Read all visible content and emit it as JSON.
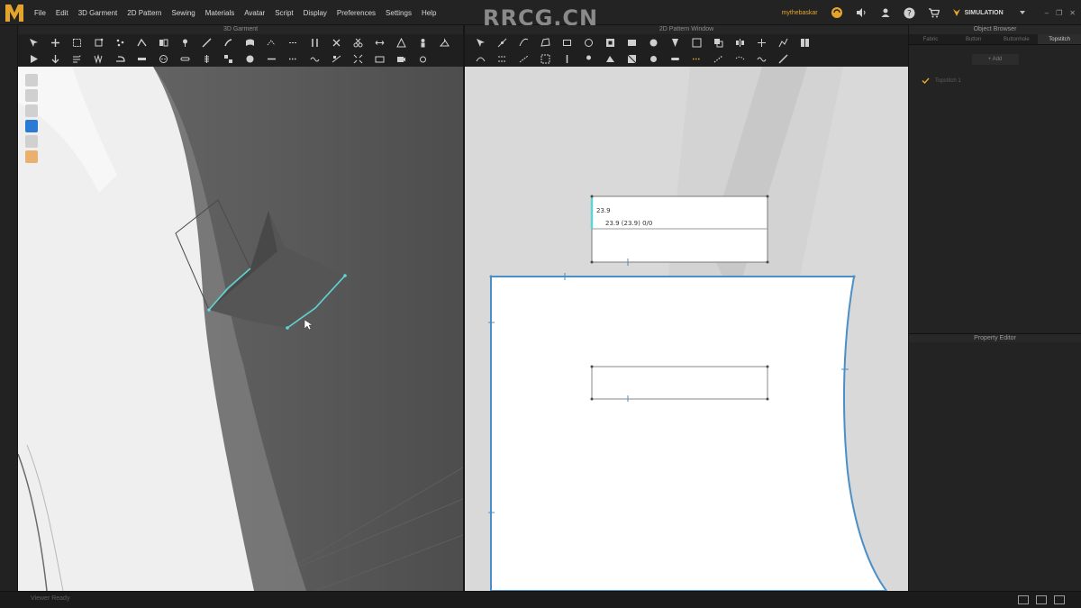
{
  "app": {
    "logo_glyph": "M",
    "brand_watermark": "RRCG.CN",
    "user_name": "mythebaskar",
    "mode_label": "SIMULATION"
  },
  "menu": [
    "File",
    "Edit",
    "3D Garment",
    "2D Pattern",
    "Sewing",
    "Materials",
    "Avatar",
    "Script",
    "Display",
    "Preferences",
    "Settings",
    "Help"
  ],
  "window3d": {
    "title": "3D Garment"
  },
  "window2d": {
    "title": "2D Pattern Window",
    "measure_length": "23.9",
    "measure_detail": "23.9 (23.9) 0/0"
  },
  "object_browser": {
    "title": "Object Browser",
    "tabs": [
      "Fabric",
      "Button",
      "Buttonhole",
      "Topstitch"
    ],
    "active_tab": "Topstitch",
    "add_label": "+ Add",
    "item_label": "Topstitch 1"
  },
  "property_editor": {
    "title": "Property Editor"
  },
  "status": {
    "text": "Viewer Ready"
  },
  "colors": {
    "accent": "#e3a42b",
    "selection": "#4a9fd8",
    "seam_highlight": "#5fd4d4"
  }
}
